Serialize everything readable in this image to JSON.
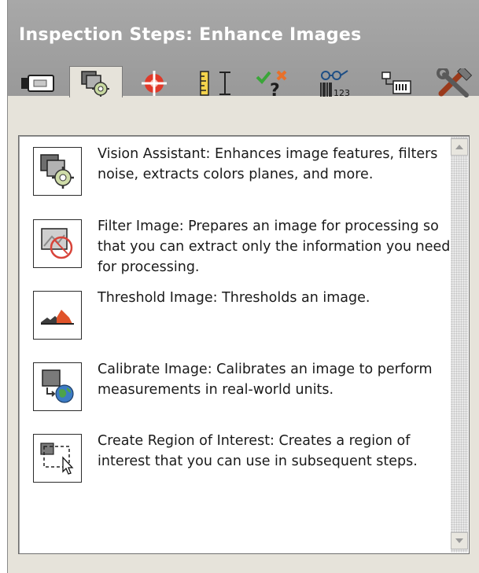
{
  "window": {
    "title": "Inspection Steps: Enhance Images"
  },
  "tabs": [
    {
      "icon": "camera-icon"
    },
    {
      "icon": "vision-assistant-gear-icon",
      "active": true
    },
    {
      "icon": "crosshair-target-icon"
    },
    {
      "icon": "ruler-caliper-icon"
    },
    {
      "icon": "check-cross-question-icon"
    },
    {
      "icon": "glasses-barcode-icon"
    },
    {
      "icon": "io-module-icon"
    },
    {
      "icon": "tools-icon"
    }
  ],
  "steps": [
    {
      "icon": "vision-assistant-icon",
      "description": "Vision Assistant:  Enhances image features, filters noise, extracts colors planes, and more."
    },
    {
      "icon": "filter-image-icon",
      "description": "Filter Image:  Prepares an image for processing so that you can extract only the information you need for processing."
    },
    {
      "icon": "threshold-image-icon",
      "description": "Threshold Image:  Thresholds an image."
    },
    {
      "icon": "calibrate-image-icon",
      "description": "Calibrate Image:  Calibrates an image to perform measurements in real-world units."
    },
    {
      "icon": "region-of-interest-icon",
      "description": "Create Region of Interest:  Creates a region of interest that you can use in subsequent steps."
    }
  ],
  "colors": {
    "titlebar": "#a0a0a0",
    "panel": "#e6e3da",
    "list_background": "#ffffff",
    "threshold_orange": "#e0532a",
    "check_green": "#3aa639",
    "cross_orange": "#e8702a"
  }
}
